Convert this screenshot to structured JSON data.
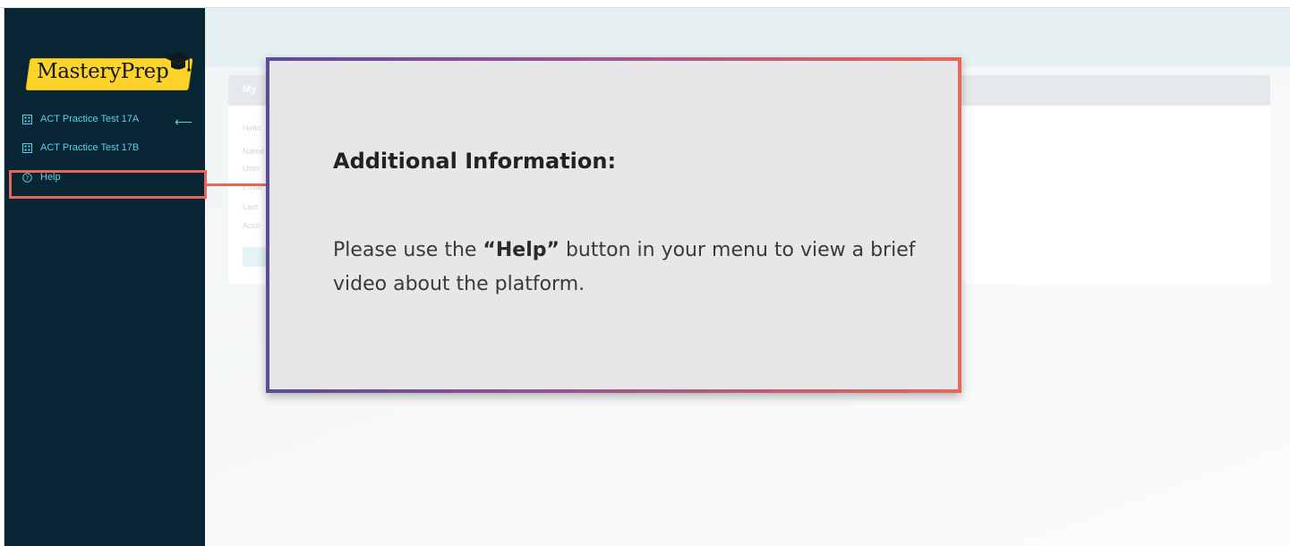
{
  "logo": {
    "text": "MasteryPrep"
  },
  "sidebar": {
    "items": [
      {
        "label": "ACT Practice Test 17A",
        "icon": "grid-icon"
      },
      {
        "label": "ACT Practice Test 17B",
        "icon": "grid-icon"
      },
      {
        "label": "Help",
        "icon": "help-circle-icon"
      }
    ]
  },
  "main": {
    "card": {
      "title": "My",
      "rows": [
        "Hello",
        "Name",
        "User",
        "Email",
        "Last",
        "Acco"
      ]
    }
  },
  "modal": {
    "title": "Additional Information:",
    "text_before": "Please use the ",
    "text_bold": "“Help”",
    "text_after": " button in your menu to view a brief video about the platform."
  },
  "colors": {
    "sidebar_bg": "#082533",
    "nav_text": "#5fd0e4",
    "highlight": "#e8655b",
    "logo_yellow": "#ffd42a",
    "modal_bg": "#e7e7e9",
    "modal_border_start": "#5c4a9a",
    "modal_border_end": "#e8655b"
  }
}
